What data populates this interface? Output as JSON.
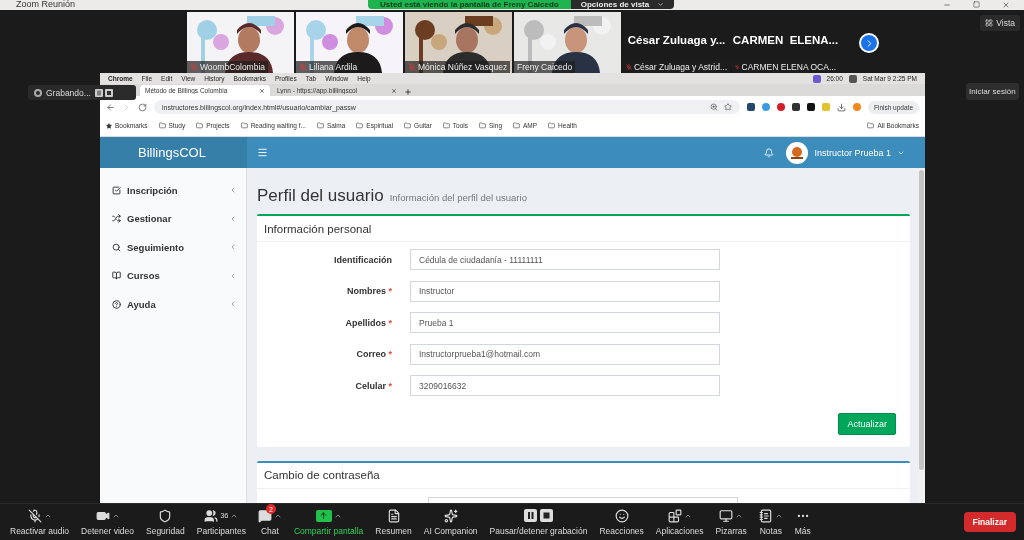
{
  "zoom_window": {
    "title": "Zoom Reunión",
    "share_banner": "Usted está viendo la pantalla de Freny Caicedo",
    "view_options": "Opciones de vista"
  },
  "participants": [
    {
      "kind": "video",
      "name": "WoombColombia",
      "muted": true
    },
    {
      "kind": "video",
      "name": "Liliana Ardila",
      "muted": true
    },
    {
      "kind": "video",
      "name": "Mónica Núñez Vasquez",
      "muted": true
    },
    {
      "kind": "video",
      "name": "Freny Caicedo",
      "muted": false
    },
    {
      "kind": "name",
      "display": "César Zuluaga y...",
      "name": "César Zuluaga y Astrid...",
      "muted": true
    },
    {
      "kind": "name",
      "display": "CARMEN  ELENA...",
      "name": "CARMEN ELENA OCA...",
      "muted": true
    }
  ],
  "view_button": "Vista",
  "recording": "Grabando...",
  "sign_in_button": "Iniciar sesión",
  "shared_screen": {
    "mac_menu": [
      "Chrome",
      "File",
      "Edit",
      "View",
      "History",
      "Bookmarks",
      "Profiles",
      "Tab",
      "Window",
      "Help"
    ],
    "timer": "26:00",
    "clock": "Sat Mar 9  2:25 PM",
    "tabs": [
      {
        "label": "Método de Billings Colombia",
        "selected": true
      },
      {
        "label": "Lynn - https://app.billingscol",
        "selected": false
      }
    ],
    "address": "instructores.billingscol.org/index.html#/usuario/cambiar_passw",
    "update_button": "Finish update",
    "bookmarks": [
      "Bookmarks",
      "Study",
      "Projects",
      "Reading waiting f...",
      "Salma",
      "Espiritual",
      "Guitar",
      "Tools",
      "Sing",
      "AMP",
      "Health"
    ],
    "all_bookmarks": "All Bookmarks",
    "app": {
      "brand": "BillingsCOL",
      "user": "Instructor Prueba 1",
      "sidebar": [
        "Inscripción",
        "Gestionar",
        "Seguimiento",
        "Cursos",
        "Ayuda"
      ],
      "page_title": "Perfil del usuario",
      "page_subtitle": "Información del perfil del usuario",
      "profile_card": {
        "title": "Información personal",
        "button": "Actualizar",
        "fields": [
          {
            "label": "Identificación",
            "value": "Cédula de ciudadanía - 11111111"
          },
          {
            "label": "Nombres",
            "mark": "*",
            "value": "Instructor"
          },
          {
            "label": "Apellidos",
            "mark": "*",
            "value": "Prueba 1"
          },
          {
            "label": "Correo",
            "mark": "*",
            "value": "Instructorprueba1@hotmail.com"
          },
          {
            "label": "Celular",
            "mark": "*",
            "value": "3209016632"
          }
        ]
      },
      "password_card": {
        "title": "Cambio de contraseña"
      }
    }
  },
  "toolbar": [
    {
      "label": "Reactivar audio",
      "menu": true,
      "highlight": false
    },
    {
      "label": "Detener video",
      "menu": true,
      "highlight": false
    },
    {
      "label": "Seguridad",
      "menu": false,
      "highlight": false
    },
    {
      "label": "Participantes",
      "count": "36",
      "menu": true,
      "highlight": false
    },
    {
      "label": "Chat",
      "badge": "2",
      "menu": true,
      "highlight": false
    },
    {
      "label": "Compartir pantalla",
      "menu": true,
      "highlight": true
    },
    {
      "label": "Resumen",
      "menu": false,
      "highlight": false
    },
    {
      "label": "AI Companion",
      "menu": false,
      "highlight": false
    },
    {
      "label": "Pausar/detener grabación",
      "menu": false,
      "highlight": false
    },
    {
      "label": "Reacciones",
      "menu": false,
      "highlight": false
    },
    {
      "label": "Aplicaciones",
      "menu": true,
      "highlight": false
    },
    {
      "label": "Pizarras",
      "menu": true,
      "highlight": false
    },
    {
      "label": "Notas",
      "menu": true,
      "highlight": false
    },
    {
      "label": "Más",
      "menu": false,
      "highlight": false
    }
  ],
  "end_button": "Finalizar"
}
